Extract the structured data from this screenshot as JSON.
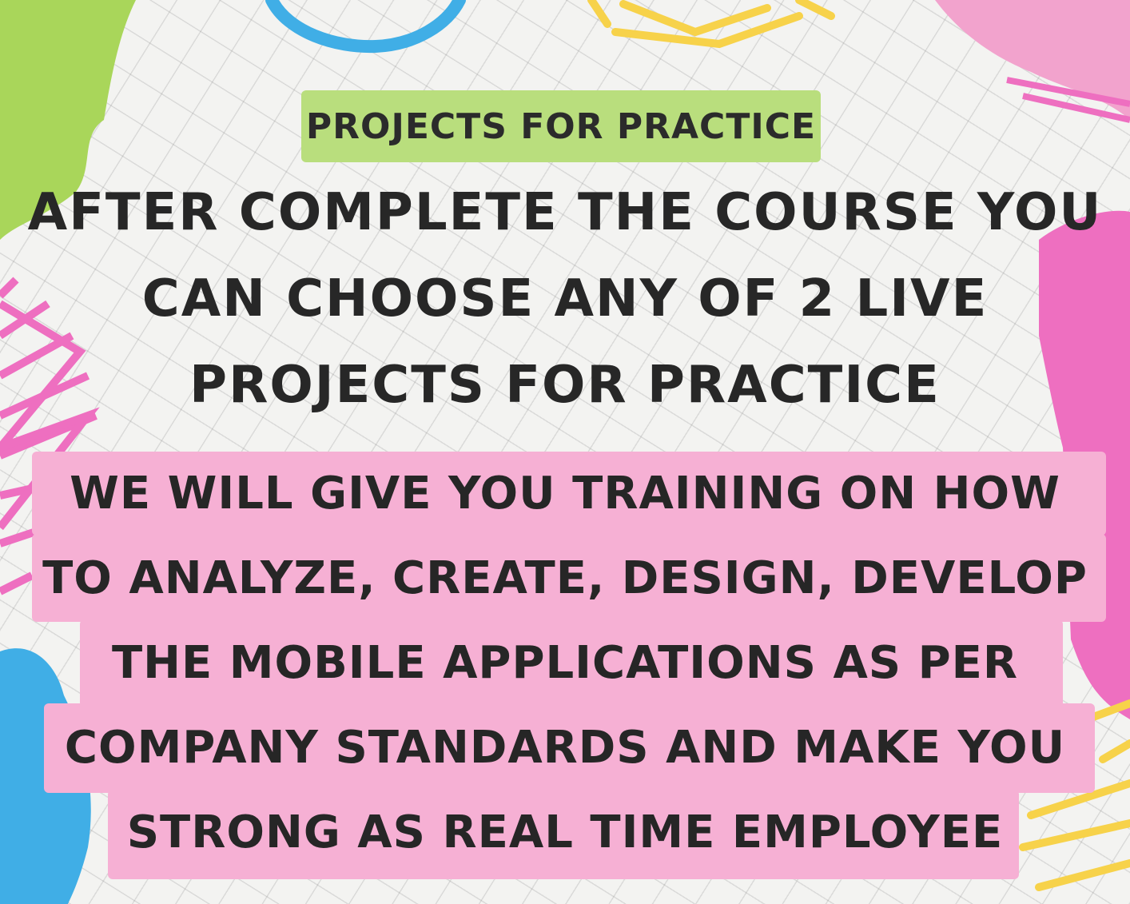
{
  "label": "PROJECTS FOR PRACTICE",
  "headline_lines": [
    "AFTER COMPLETE THE COURSE YOU",
    "CAN CHOOSE ANY OF 2 LIVE",
    "PROJECTS FOR PRACTICE"
  ],
  "body_lines": [
    "WE WILL GIVE YOU TRAINING ON HOW",
    "TO ANALYZE, CREATE, DESIGN, DEVELOP",
    "THE MOBILE APPLICATIONS AS PER",
    "COMPANY STANDARDS AND MAKE YOU",
    "STRONG AS REAL TIME EMPLOYEE"
  ],
  "colors": {
    "label_bg": "#b9de7d",
    "body_bg": "#f6b0d4",
    "text": "#272727",
    "accent_green": "#a9d65a",
    "accent_pink": "#ee6fc0",
    "accent_blue": "#40aee6",
    "accent_yellow": "#f7d24a"
  }
}
